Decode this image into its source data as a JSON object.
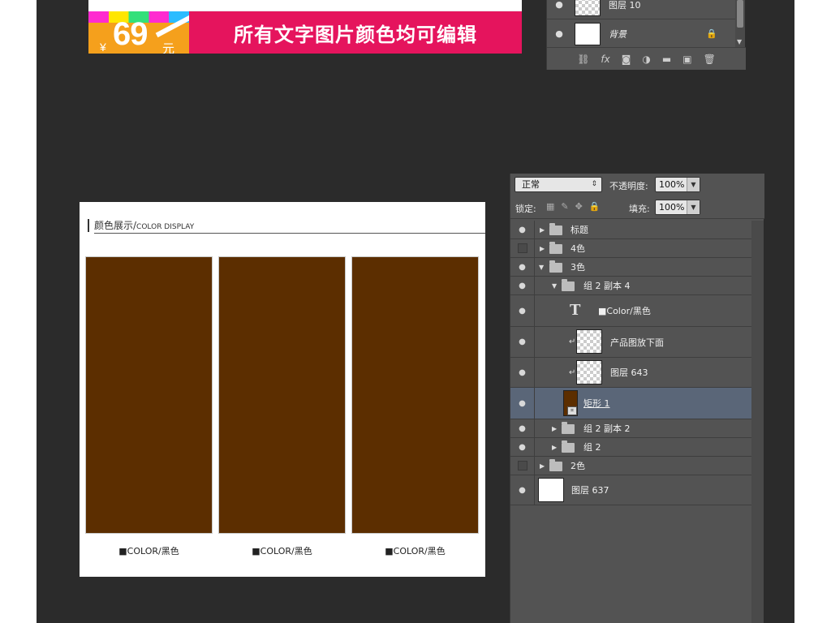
{
  "banner": {
    "currency": "¥",
    "price": "69",
    "unit": "元",
    "slogan": "所有文字图片颜色均可编辑"
  },
  "top_panel": {
    "layers": [
      {
        "name": "图层 10",
        "thumb": "checker",
        "visible": true
      },
      {
        "name": "背景",
        "thumb": "white",
        "visible": true,
        "locked": true,
        "italic": true
      }
    ],
    "footer_icons": [
      "link-icon",
      "fx-icon",
      "mask-icon",
      "adjustment-icon",
      "group-icon",
      "new-layer-icon",
      "trash-icon"
    ]
  },
  "card": {
    "title_cn": "颜色展示/",
    "title_en": "COLOR DISPLAY",
    "swatch_color": "#5c2e00",
    "swatches": [
      {
        "label": "■COLOR/黑色"
      },
      {
        "label": "■COLOR/黑色"
      },
      {
        "label": "■COLOR/黑色"
      }
    ]
  },
  "layers_panel": {
    "blend_mode": "正常",
    "opacity_label": "不透明度:",
    "opacity_value": "100%",
    "lock_label": "锁定:",
    "fill_label": "填充:",
    "fill_value": "100%",
    "rows": [
      {
        "name": "标题",
        "type": "group",
        "visible": true
      },
      {
        "name": "4色",
        "type": "group",
        "visible": false
      },
      {
        "name": "3色",
        "type": "group-open",
        "visible": true
      },
      {
        "name": "组 2 副本 4",
        "type": "group-open",
        "visible": true
      },
      {
        "name": "■Color/黑色",
        "type": "text",
        "visible": true
      },
      {
        "name": "产品图放下面",
        "type": "pixel",
        "visible": true
      },
      {
        "name": "图层 643",
        "type": "pixel",
        "visible": true
      },
      {
        "name": "矩形 1",
        "type": "shape",
        "visible": true,
        "selected": true
      },
      {
        "name": "组 2 副本 2",
        "type": "group",
        "visible": true
      },
      {
        "name": "组 2",
        "type": "group",
        "visible": true
      },
      {
        "name": "2色",
        "type": "group",
        "visible": false
      },
      {
        "name": "图层 637",
        "type": "pixel-white",
        "visible": true
      }
    ]
  }
}
